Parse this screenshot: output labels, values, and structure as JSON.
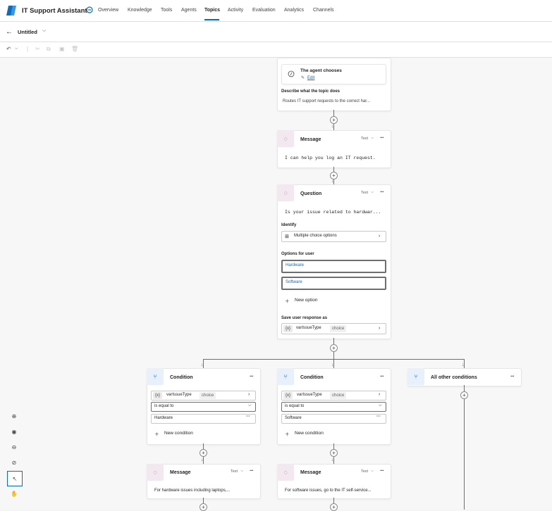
{
  "app": {
    "title": "IT Support Assistant"
  },
  "nav": {
    "tabs": [
      "Overview",
      "Knowledge",
      "Tools",
      "Agents",
      "Topics",
      "Activity",
      "Evaluation",
      "Analytics",
      "Channels"
    ],
    "active": "Topics"
  },
  "subbar": {
    "topic_name": "Untitled"
  },
  "trigger": {
    "title": "The agent chooses",
    "edit_label": "Edit",
    "describe_label": "Describe what the topic does",
    "describe_value": "Routes IT support requests to the correct har..."
  },
  "message1": {
    "title": "Message",
    "format": "Text",
    "text": "I can help you log an IT request."
  },
  "question": {
    "title": "Question",
    "format": "Text",
    "text": "Is your issue related to hardwar...",
    "identify_label": "Identify",
    "identify_value": "Multiple choice options",
    "options_label": "Options for user",
    "options": [
      "Hardware",
      "Software"
    ],
    "new_option": "New option",
    "save_label": "Save user response as",
    "var_name": "varIssueType",
    "var_type": "choice"
  },
  "conditions": [
    {
      "title": "Condition",
      "var": "varIssueType",
      "type": "choice",
      "operator": "is equal to",
      "value": "Hardware",
      "new_condition": "New condition"
    },
    {
      "title": "Condition",
      "var": "varIssueType",
      "type": "choice",
      "operator": "is equal to",
      "value": "Software",
      "new_condition": "New condition"
    },
    {
      "title": "All other conditions"
    }
  ],
  "messages2": [
    {
      "title": "Message",
      "format": "Text",
      "text": "For hardware issues including laptops,..."
    },
    {
      "title": "Message",
      "format": "Text",
      "text": "For software issues, go to the IT self-service..."
    }
  ],
  "icons": {
    "logo": "app-logo-icon",
    "edit": "pencil-icon",
    "message": "chat-bubble-icon",
    "condition": "branch-icon",
    "variable": "variable-icon",
    "zoom_in": "zoom-in-icon",
    "fit": "target-icon",
    "zoom_out": "zoom-out-icon",
    "minimap": "minimap-icon",
    "select": "select-cursor-icon",
    "pan": "hand-icon"
  },
  "colors": {
    "accent": "#0f6cbd",
    "message_icon_bg": "#f3e8f0",
    "condition_icon_bg": "#e8f1fb"
  }
}
